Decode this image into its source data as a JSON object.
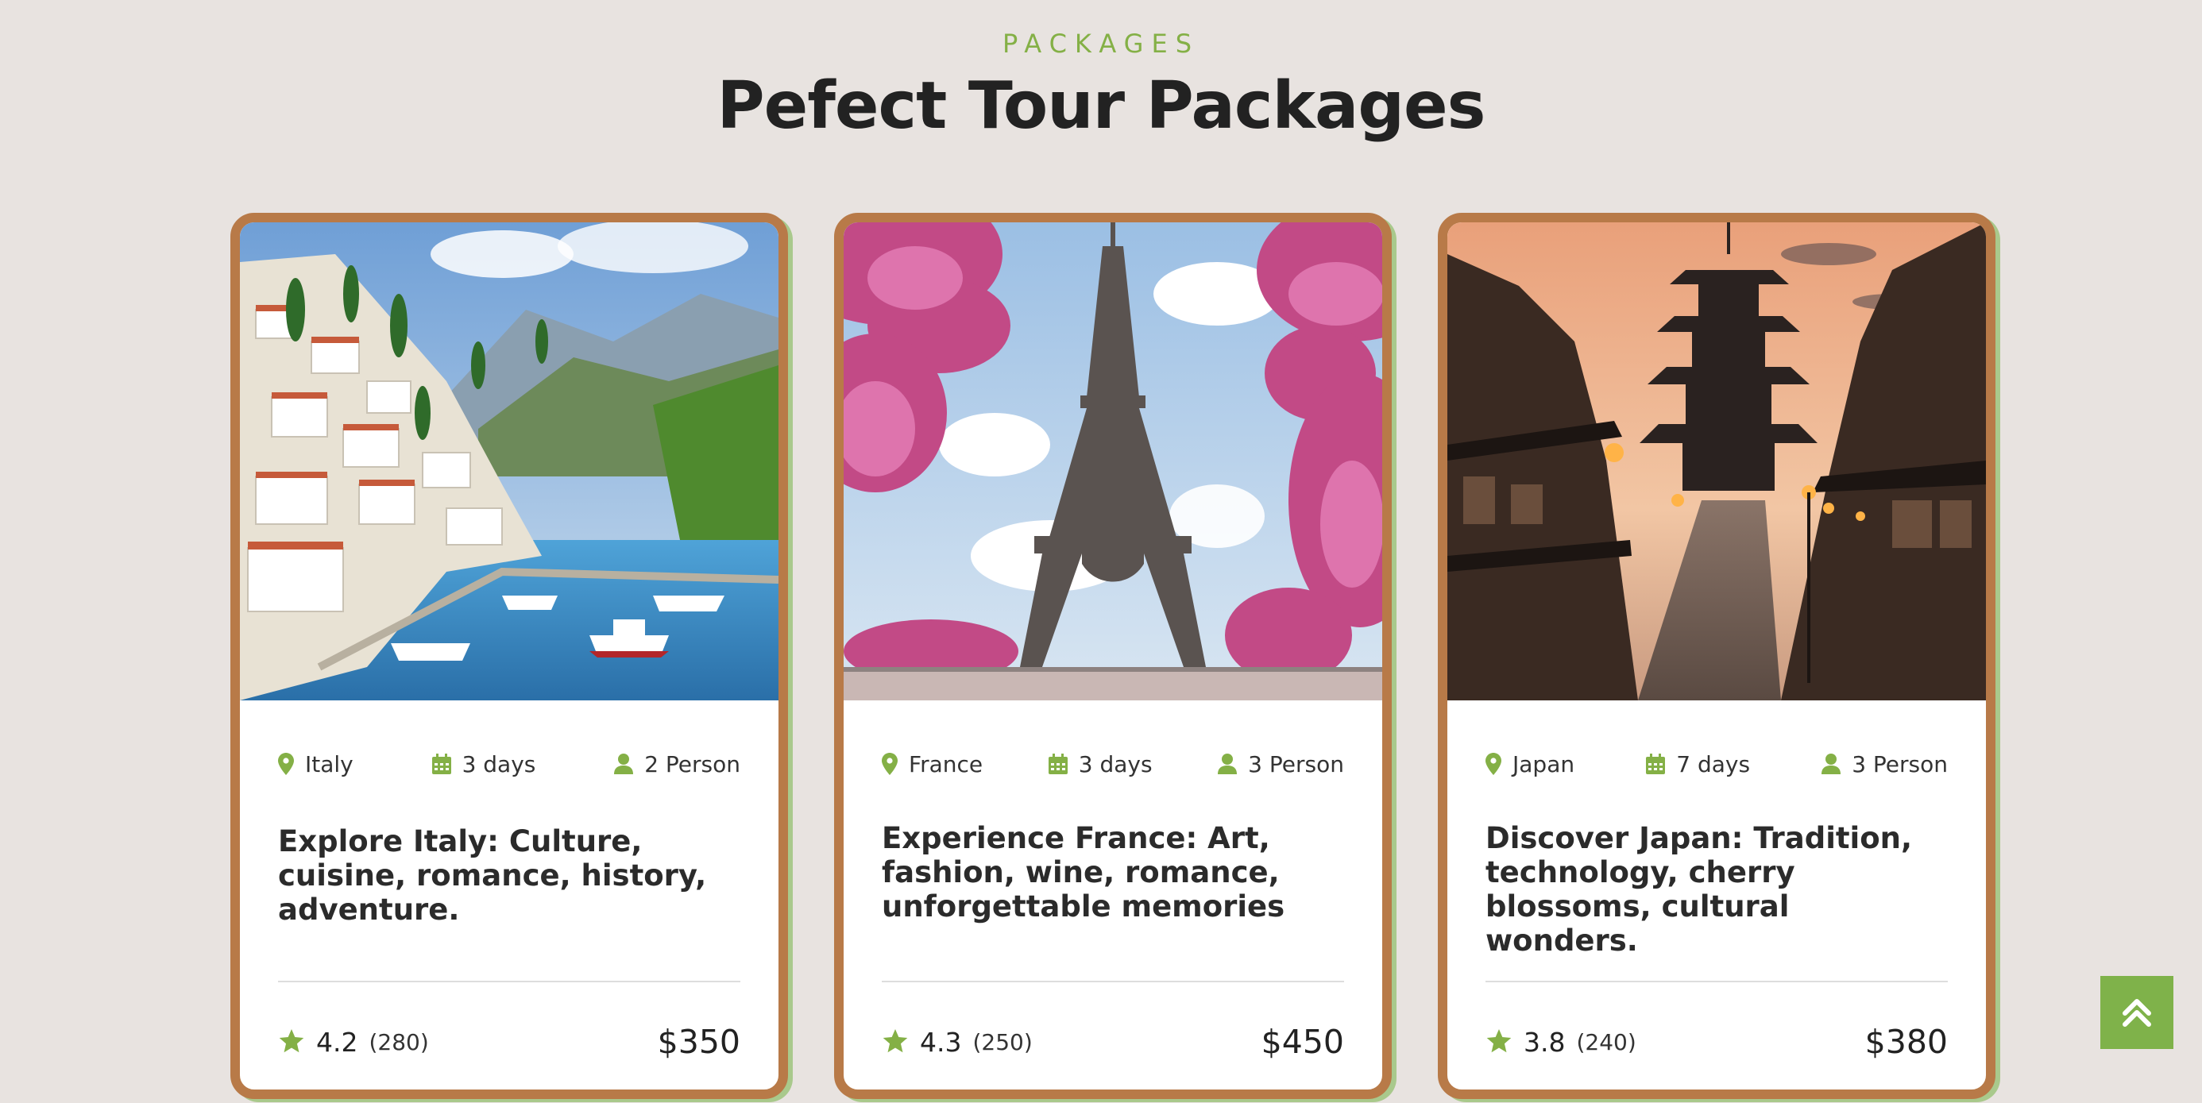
{
  "section": {
    "eyebrow": "PACKAGES",
    "title": "Pefect Tour Packages"
  },
  "colors": {
    "accent": "#84b046",
    "card_border": "#b87a48",
    "background": "#e8e3e0"
  },
  "icons": {
    "location": "map-pin-icon",
    "duration": "calendar-icon",
    "people": "person-icon",
    "rating": "star-icon",
    "scroll": "chevron-double-up-icon"
  },
  "packages": [
    {
      "image": "italy-coastal-village-harbor-photo",
      "location": "Italy",
      "duration": "3 days",
      "people": "2 Person",
      "title": "Explore Italy: Culture, cuisine, romance, history, adventure.",
      "rating": "4.2",
      "reviews": "(280)",
      "price": "$350"
    },
    {
      "image": "eiffel-tower-cherry-blossom-photo",
      "location": "France",
      "duration": "3 days",
      "people": "3 Person",
      "title": "Experience France: Art, fashion, wine, romance, unforgettable memories",
      "rating": "4.3",
      "reviews": "(250)",
      "price": "$450"
    },
    {
      "image": "japan-pagoda-street-dusk-photo",
      "location": "Japan",
      "duration": "7 days",
      "people": "3 Person",
      "title": "Discover Japan: Tradition, technology, cherry blossoms, cultural wonders.",
      "rating": "3.8",
      "reviews": "(240)",
      "price": "$380"
    }
  ]
}
